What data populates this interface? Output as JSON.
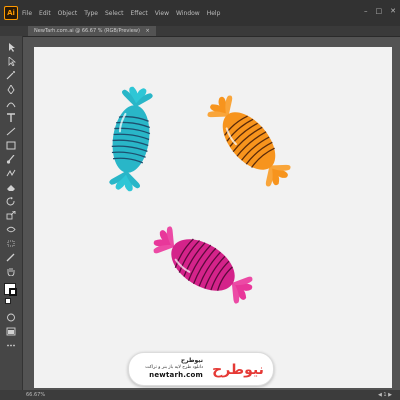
{
  "menubar": {
    "logo": "Ai",
    "items": [
      "File",
      "Edit",
      "Object",
      "Type",
      "Select",
      "Effect",
      "View",
      "Window",
      "Help"
    ],
    "minimize": "–",
    "maximize": "□",
    "close": "✕"
  },
  "document": {
    "tab_title": "NewTarh.com.ai @ 66.67 % (RGB/Preview)",
    "tab_close": "×"
  },
  "statusbar": {
    "zoom": "66.67%",
    "controls": "◀  1  ▶"
  },
  "candies": [
    {
      "name": "blue",
      "color": "#29b6c8",
      "dark": "#1a8a99",
      "wrapper": "#2ec6d6"
    },
    {
      "name": "orange",
      "color": "#f7941d",
      "dark": "#d8700a",
      "wrapper": "#f7941d"
    },
    {
      "name": "pink",
      "color": "#d4238a",
      "dark": "#9e1466",
      "wrapper": "#e8379a"
    }
  ],
  "watermark": {
    "name": "نیوطرح",
    "tagline": "دانلود طرح لایه باز بنر و تراکت",
    "url": "newtarh.com",
    "logo_text": "نیوطرح",
    "logo_color": "#e53935"
  },
  "colors": {
    "ui_dark": "#323232",
    "toolbar": "#464646",
    "artboard": "#f2f2f2",
    "pasteboard": "#535353"
  }
}
